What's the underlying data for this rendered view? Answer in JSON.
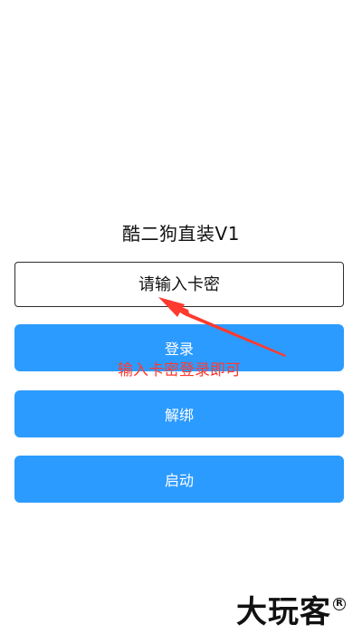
{
  "app": {
    "title": "酷二狗直装V1"
  },
  "form": {
    "placeholder": "请输入卡密"
  },
  "buttons": {
    "login": "登录",
    "unbind": "解绑",
    "start": "启动"
  },
  "annotation": {
    "text": "输入卡密登录即可",
    "color": "#ff3a2f"
  },
  "watermark": {
    "text": "大玩客",
    "mark": "R"
  },
  "colors": {
    "button_primary": "#2c9bff",
    "background": "#ffffff",
    "input_border": "#2e2e2e",
    "title_text": "#111111"
  }
}
